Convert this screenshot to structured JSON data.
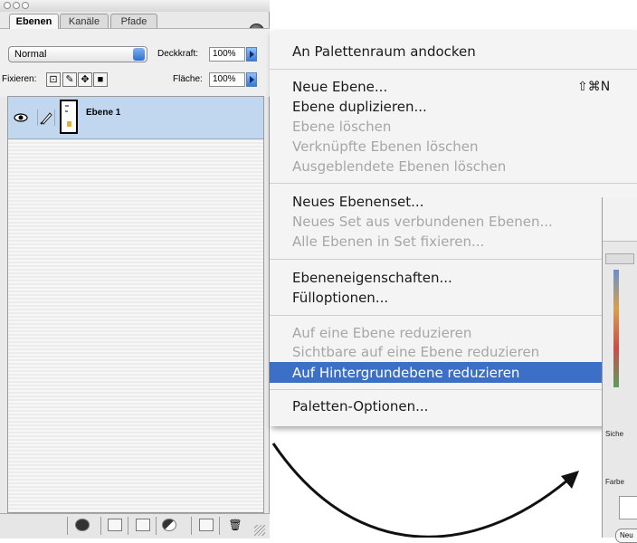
{
  "palette": {
    "tabs": [
      "Ebenen",
      "Kanäle",
      "Pfade"
    ],
    "blend_mode": "Normal",
    "opacity_label": "Deckkraft:",
    "opacity_value": "100%",
    "lock_label": "Fixieren:",
    "fill_label": "Fläche:",
    "fill_value": "100%",
    "layer_name": "Ebene 1"
  },
  "menu": {
    "items": [
      {
        "label": "An Palettenraum andocken",
        "enabled": true
      },
      {
        "label": "Neue Ebene...",
        "enabled": true,
        "shortcut": "⇧⌘N"
      },
      {
        "label": "Ebene duplizieren...",
        "enabled": true
      },
      {
        "label": "Ebene löschen",
        "enabled": false
      },
      {
        "label": "Verknüpfte Ebenen löschen",
        "enabled": false
      },
      {
        "label": "Ausgeblendete Ebenen löschen",
        "enabled": false
      },
      {
        "label": "Neues Ebenenset...",
        "enabled": true
      },
      {
        "label": "Neues Set aus verbundenen Ebenen...",
        "enabled": false
      },
      {
        "label": "Alle Ebenen in Set fixieren...",
        "enabled": false
      },
      {
        "label": "Ebeneneigenschaften...",
        "enabled": true
      },
      {
        "label": "Fülloptionen...",
        "enabled": true
      },
      {
        "label": "Auf eine Ebene reduzieren",
        "enabled": false
      },
      {
        "label": "Sichtbare auf eine Ebene reduzieren",
        "enabled": false,
        "shortcut": "⇧⌘"
      },
      {
        "label": "Auf Hintergrundebene reduzieren",
        "enabled": true,
        "highlighted": true,
        "shortcut": "⌘"
      },
      {
        "label": "Paletten-Optionen...",
        "enabled": true
      }
    ]
  },
  "dialog": {
    "label_1": "Siche",
    "label_2": "Farbe",
    "button": "Neu"
  },
  "colors": {
    "menu_highlight": "#3c6fc6",
    "selected_layer": "#c1d6ef"
  }
}
